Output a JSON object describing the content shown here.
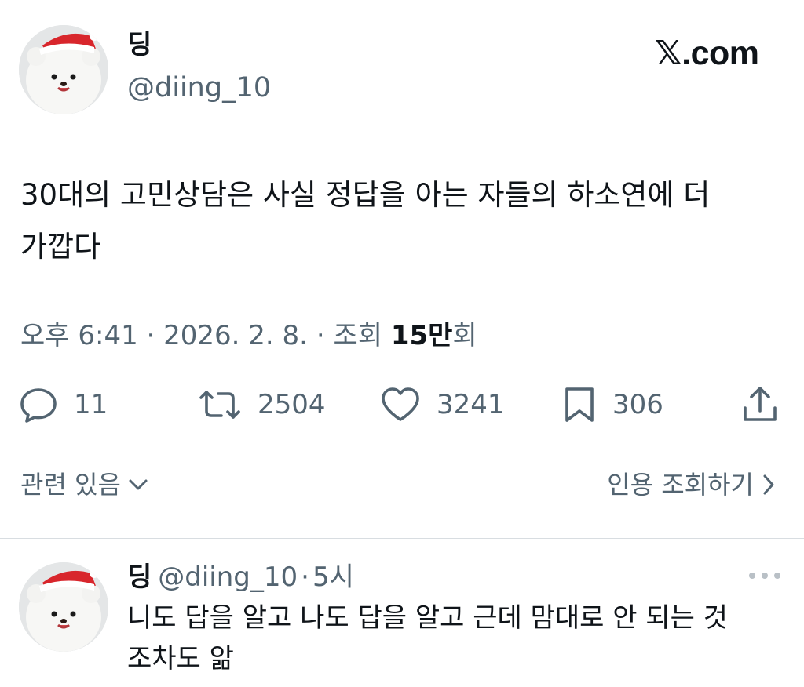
{
  "tweet": {
    "author_name": "딩",
    "author_handle": "@diing_10",
    "text": "30대의 고민상담은 사실 정답을 아는 자들의 하소연에 더 가깝다",
    "time": "오후 6:41",
    "date": "2026. 2. 8.",
    "views_label": "조회",
    "views_value": "15만",
    "views_suffix": "회",
    "separator": "·"
  },
  "brand": {
    "logo_text": "𝕏.com"
  },
  "actions": {
    "replies": "11",
    "retweets": "2504",
    "likes": "3241",
    "bookmarks": "306"
  },
  "related": {
    "label": "관련 있음",
    "quote_label": "인용 조회하기"
  },
  "reply": {
    "author_name": "딩",
    "author_handle": "@diing_10",
    "separator": "·",
    "time": "5시",
    "text": "니도 답을 알고 나도 답을 알고 근데 맘대로 안 되는 것 조차도 앎"
  },
  "icons": {
    "reply": "speech-bubble-icon",
    "retweet": "retweet-arrows-icon",
    "like": "heart-icon",
    "bookmark": "bookmark-icon",
    "share": "share-upload-icon",
    "more": "more-dots-icon",
    "chevron_down": "chevron-down-icon",
    "chevron_right": "chevron-right-icon"
  },
  "colors": {
    "text_primary": "#0f1419",
    "text_secondary": "#536471",
    "divider": "#d8dde1"
  }
}
